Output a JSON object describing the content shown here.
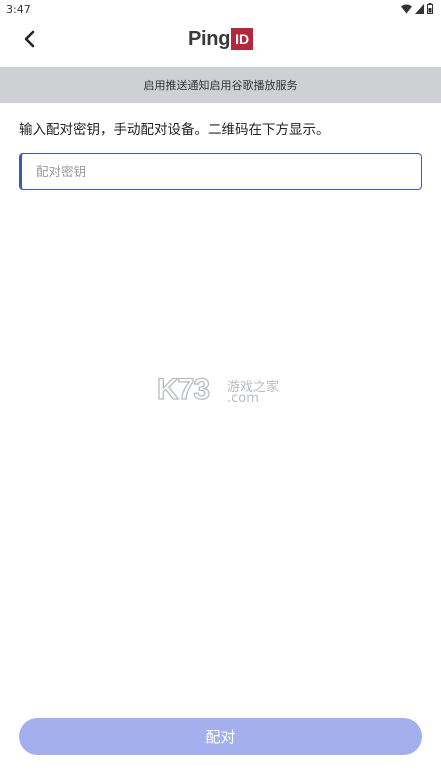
{
  "status_bar": {
    "time": "3:47"
  },
  "logo": {
    "ping": "Ping",
    "id": "ID"
  },
  "banner": {
    "text": "启用推送通知启用谷歌播放服务"
  },
  "instruction": {
    "text": "输入配对密钥，手动配对设备。二维码在下方显示。"
  },
  "key_input": {
    "placeholder": "配对密钥",
    "value": ""
  },
  "watermark": {
    "k73": "K73",
    "site": "游戏之家",
    "domain": ".com"
  },
  "pair_button": {
    "label": "配对"
  },
  "colors": {
    "accent": "#3b5bb3",
    "button_disabled": "#a4b0ee",
    "banner_bg": "#cfd0d4",
    "logo_red": "#b3283a"
  },
  "icons": [
    "wifi-icon",
    "signal-icon",
    "battery-icon",
    "back-arrow-icon"
  ]
}
